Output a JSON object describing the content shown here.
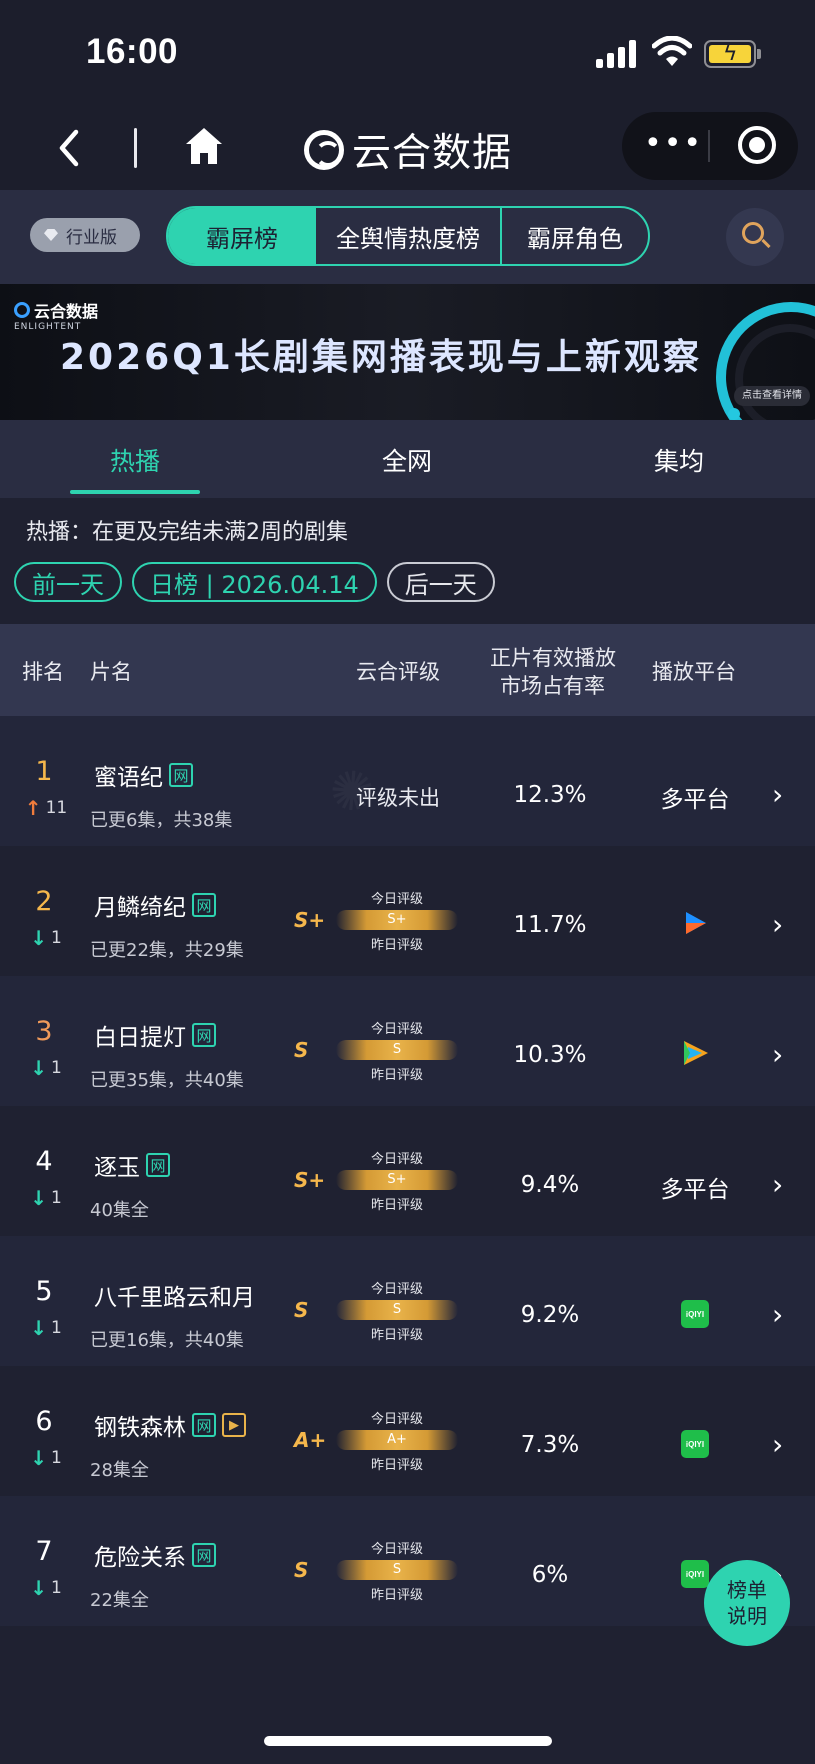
{
  "status": {
    "time": "16:00"
  },
  "nav": {
    "logo_text": "云合数据"
  },
  "edition_label": "行业版",
  "segments": [
    "霸屏榜",
    "全舆情热度榜",
    "霸屏角色"
  ],
  "banner": {
    "title": "2026Q1长剧集网播表现与上新观察",
    "brand_cn": "云合数据",
    "brand_en": "ENLIGHTENT",
    "cta": "点击查看详情"
  },
  "tabs": [
    "热播",
    "全网",
    "集均"
  ],
  "info_text": "热播：在更及完结未满2周的剧集",
  "chips": {
    "prev": "前一天",
    "current": "日榜 | 2026.04.14",
    "next": "后一天"
  },
  "table_header": {
    "rank": "排名",
    "name": "片名",
    "rating": "云合评级",
    "share_line1": "正片有效播放",
    "share_line2": "市场占有率",
    "platform": "播放平台"
  },
  "rating_labels": {
    "today": "今日评级",
    "yesterday": "昨日评级"
  },
  "rows": [
    {
      "rank": "1",
      "trend": "up",
      "change": "11",
      "title": "蜜语纪",
      "tags": [
        "网"
      ],
      "subtitle": "已更6集，共38集",
      "rating_text": "评级未出",
      "grade": "",
      "share": "12.3%",
      "platform": "多平台",
      "platform_icon": ""
    },
    {
      "rank": "2",
      "trend": "down",
      "change": "1",
      "title": "月鳞绮纪",
      "tags": [
        "网"
      ],
      "subtitle": "已更22集，共29集",
      "rating_text": "",
      "grade": "S+",
      "share": "11.7%",
      "platform": "",
      "platform_icon": "youku-icon"
    },
    {
      "rank": "3",
      "trend": "down",
      "change": "1",
      "title": "白日提灯",
      "tags": [
        "网"
      ],
      "subtitle": "已更35集，共40集",
      "rating_text": "",
      "grade": "S",
      "share": "10.3%",
      "platform": "",
      "platform_icon": "tencent-video-icon"
    },
    {
      "rank": "4",
      "trend": "down",
      "change": "1",
      "title": "逐玉",
      "tags": [
        "网"
      ],
      "subtitle": "40集全",
      "rating_text": "",
      "grade": "S+",
      "share": "9.4%",
      "platform": "多平台",
      "platform_icon": ""
    },
    {
      "rank": "5",
      "trend": "down",
      "change": "1",
      "title": "八千里路云和月",
      "tags": [],
      "subtitle": "已更16集，共40集",
      "rating_text": "",
      "grade": "S",
      "share": "9.2%",
      "platform": "",
      "platform_icon": "iqiyi-icon"
    },
    {
      "rank": "6",
      "trend": "down",
      "change": "1",
      "title": "钢铁森林",
      "tags": [
        "网",
        "▶"
      ],
      "subtitle": "28集全",
      "rating_text": "",
      "grade": "A+",
      "share": "7.3%",
      "platform": "",
      "platform_icon": "iqiyi-icon"
    },
    {
      "rank": "7",
      "trend": "down",
      "change": "1",
      "title": "危险关系",
      "tags": [
        "网"
      ],
      "subtitle": "22集全",
      "rating_text": "",
      "grade": "S",
      "share": "6%",
      "platform": "",
      "platform_icon": "iqiyi-icon"
    }
  ],
  "iqiyi_text": "iQIYI",
  "fab": {
    "line1": "榜单",
    "line2": "说明"
  },
  "colors": {
    "accent": "#2ed3b0",
    "gold": "#e9b34a",
    "bg": "#1f2131"
  }
}
